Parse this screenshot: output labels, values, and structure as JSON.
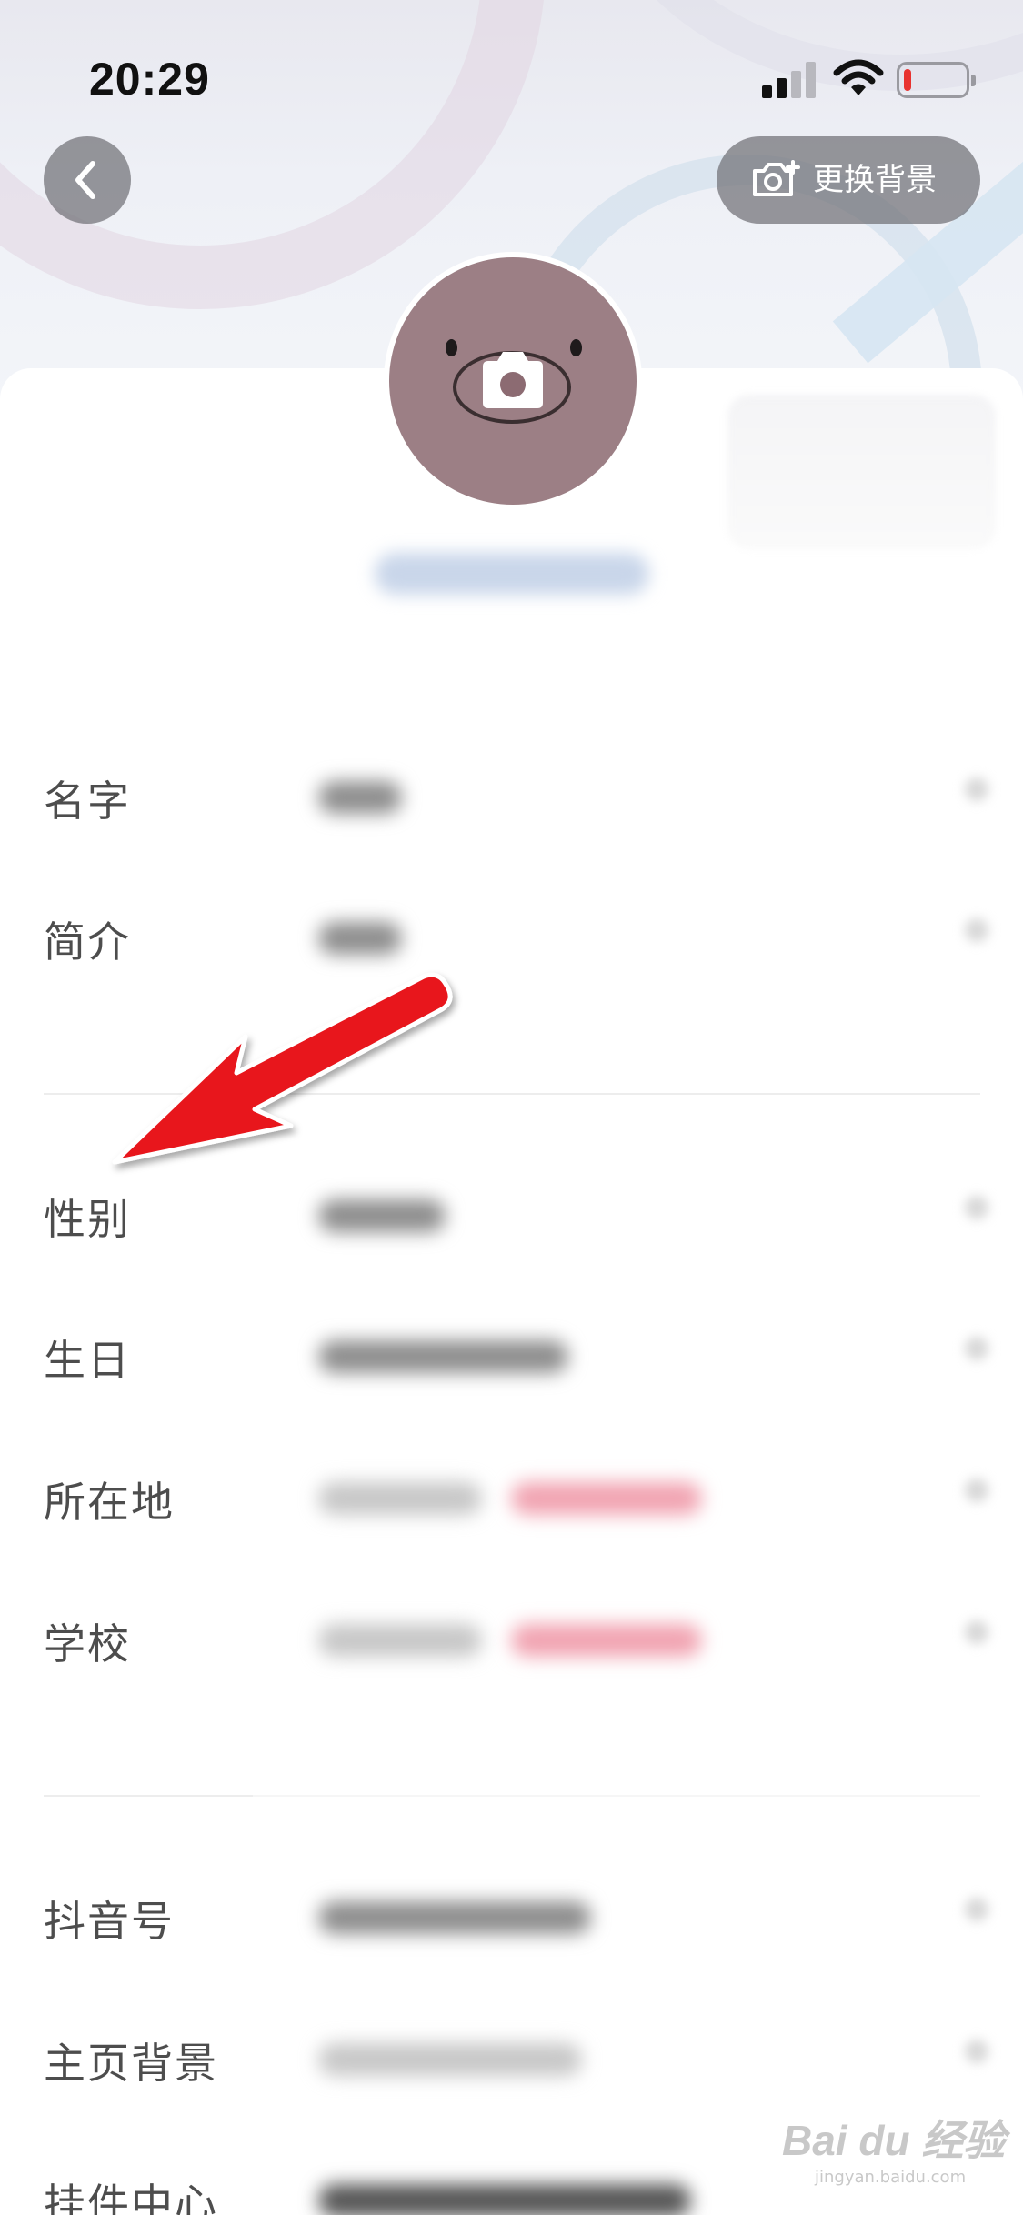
{
  "status_bar": {
    "time": "20:29",
    "signal_bars_active": 2,
    "battery_level": 0.12,
    "battery_color": "#e8322f"
  },
  "header": {
    "back_icon": "chevron-left-icon",
    "change_background_label": "更换背景",
    "change_background_icon": "camera-plus-icon"
  },
  "avatar": {
    "overlay_icon": "camera-icon",
    "color": "#9c7f85"
  },
  "profile_fields": {
    "group1": [
      {
        "label": "名字"
      },
      {
        "label": "简介"
      }
    ],
    "group2": [
      {
        "label": "性别"
      },
      {
        "label": "生日"
      },
      {
        "label": "所在地"
      },
      {
        "label": "学校"
      }
    ],
    "group3": [
      {
        "label": "抖音号"
      },
      {
        "label": "主页背景"
      },
      {
        "label": "挂件中心"
      }
    ]
  },
  "annotation": {
    "arrow_color": "#e8141a",
    "arrow_points_to": "性别"
  },
  "watermark": {
    "text": "Bai du 经验",
    "sub": "jingyan.baidu.com"
  }
}
